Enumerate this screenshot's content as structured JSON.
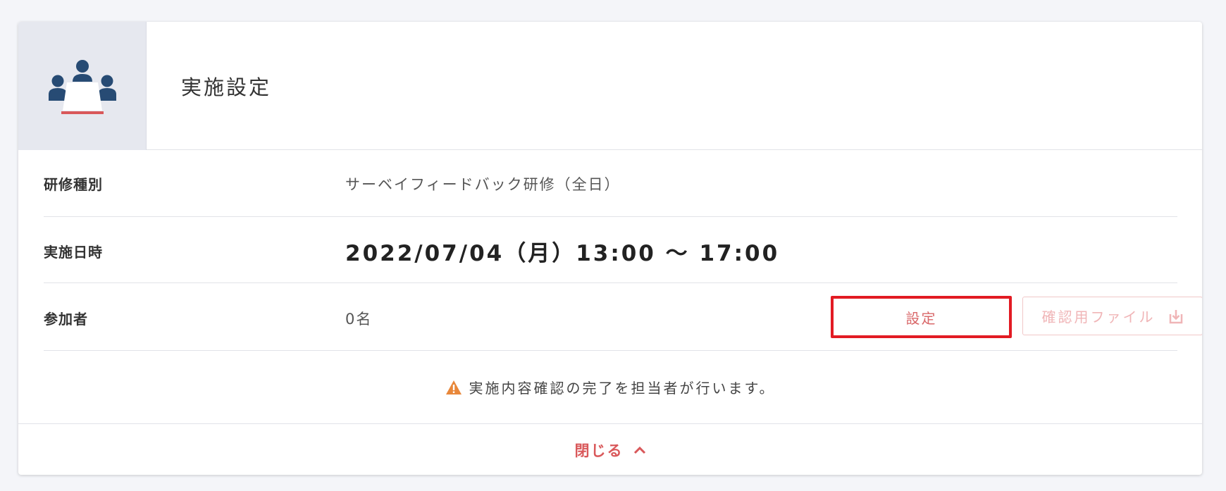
{
  "header": {
    "title": "実施設定",
    "icon": "meeting-people-icon"
  },
  "rows": {
    "training_type": {
      "label": "研修種別",
      "value": "サーベイフィードバック研修（全日）"
    },
    "schedule": {
      "label": "実施日時",
      "value": "2022/07/04（月）13:00 ～ 17:00"
    },
    "participants": {
      "label": "参加者",
      "value": "0名",
      "settings_button": "設定",
      "file_button": "確認用ファイル",
      "file_button_icon": "download-icon"
    }
  },
  "notice": {
    "icon": "warning-icon",
    "text": "実施内容確認の完了を担当者が行います。"
  },
  "footer": {
    "close_label": "閉じる",
    "close_icon": "chevron-up-icon"
  },
  "colors": {
    "accent": "#d9585a",
    "highlight_border": "#e21b23",
    "icon_blue": "#274b74",
    "warning": "#e8873a"
  }
}
